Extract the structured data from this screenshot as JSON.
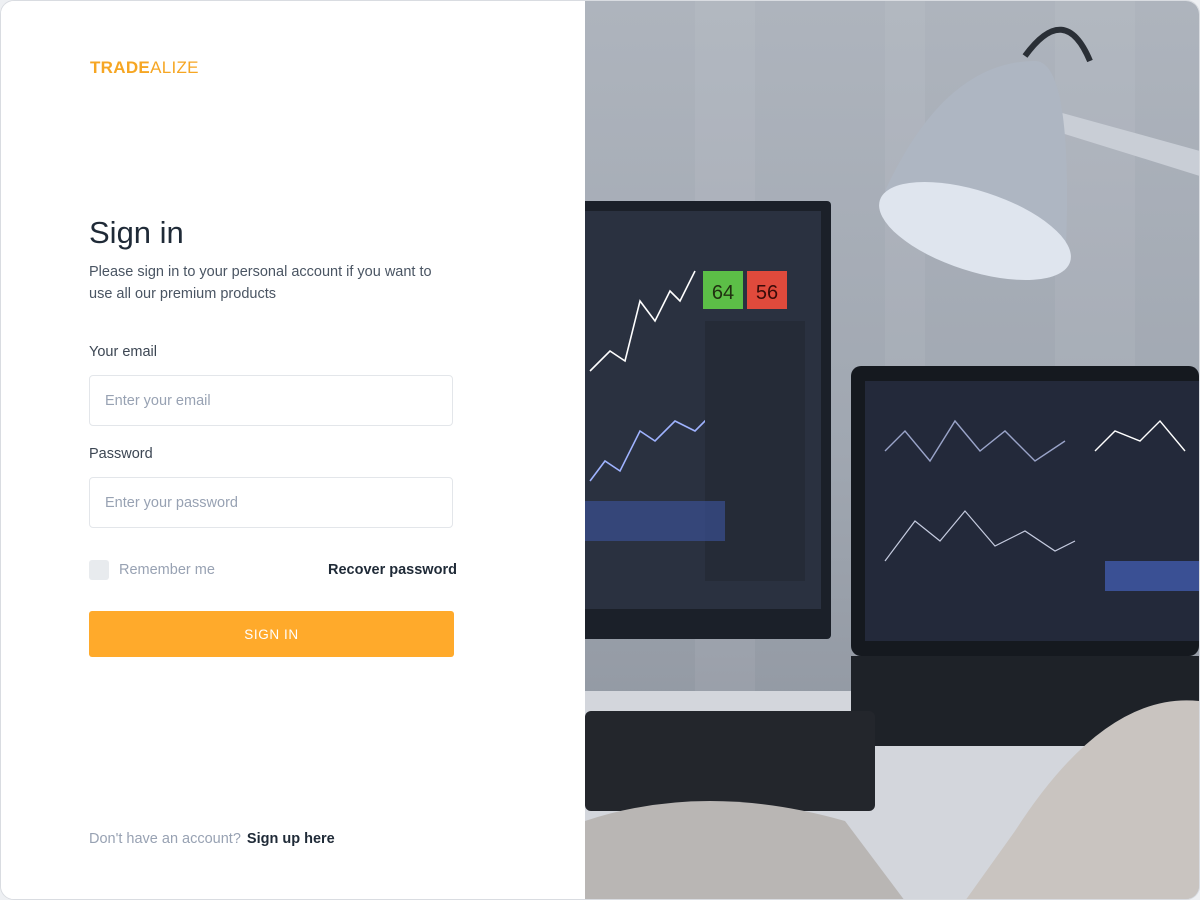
{
  "brand": {
    "part1": "TRADE",
    "part2": "ALIZE"
  },
  "signin": {
    "title": "Sign in",
    "subtitle": "Please sign in to your personal account if you want to use all our premium products",
    "email_label": "Your email",
    "email_placeholder": "Enter your email",
    "password_label": "Password",
    "password_placeholder": "Enter your password",
    "remember_label": "Remember me",
    "remember_checked": false,
    "recover_label": "Recover password",
    "submit_label": "SIGN IN"
  },
  "footer": {
    "prompt": "Don't have an account?",
    "signup_label": "Sign up here"
  },
  "chart_labels": {
    "left_badge": "64",
    "right_badge": "56"
  },
  "colors": {
    "accent": "#ffaa2b",
    "brand": "#f6a623",
    "text_dark": "#1f2a37",
    "text_muted": "#98a2b3"
  }
}
